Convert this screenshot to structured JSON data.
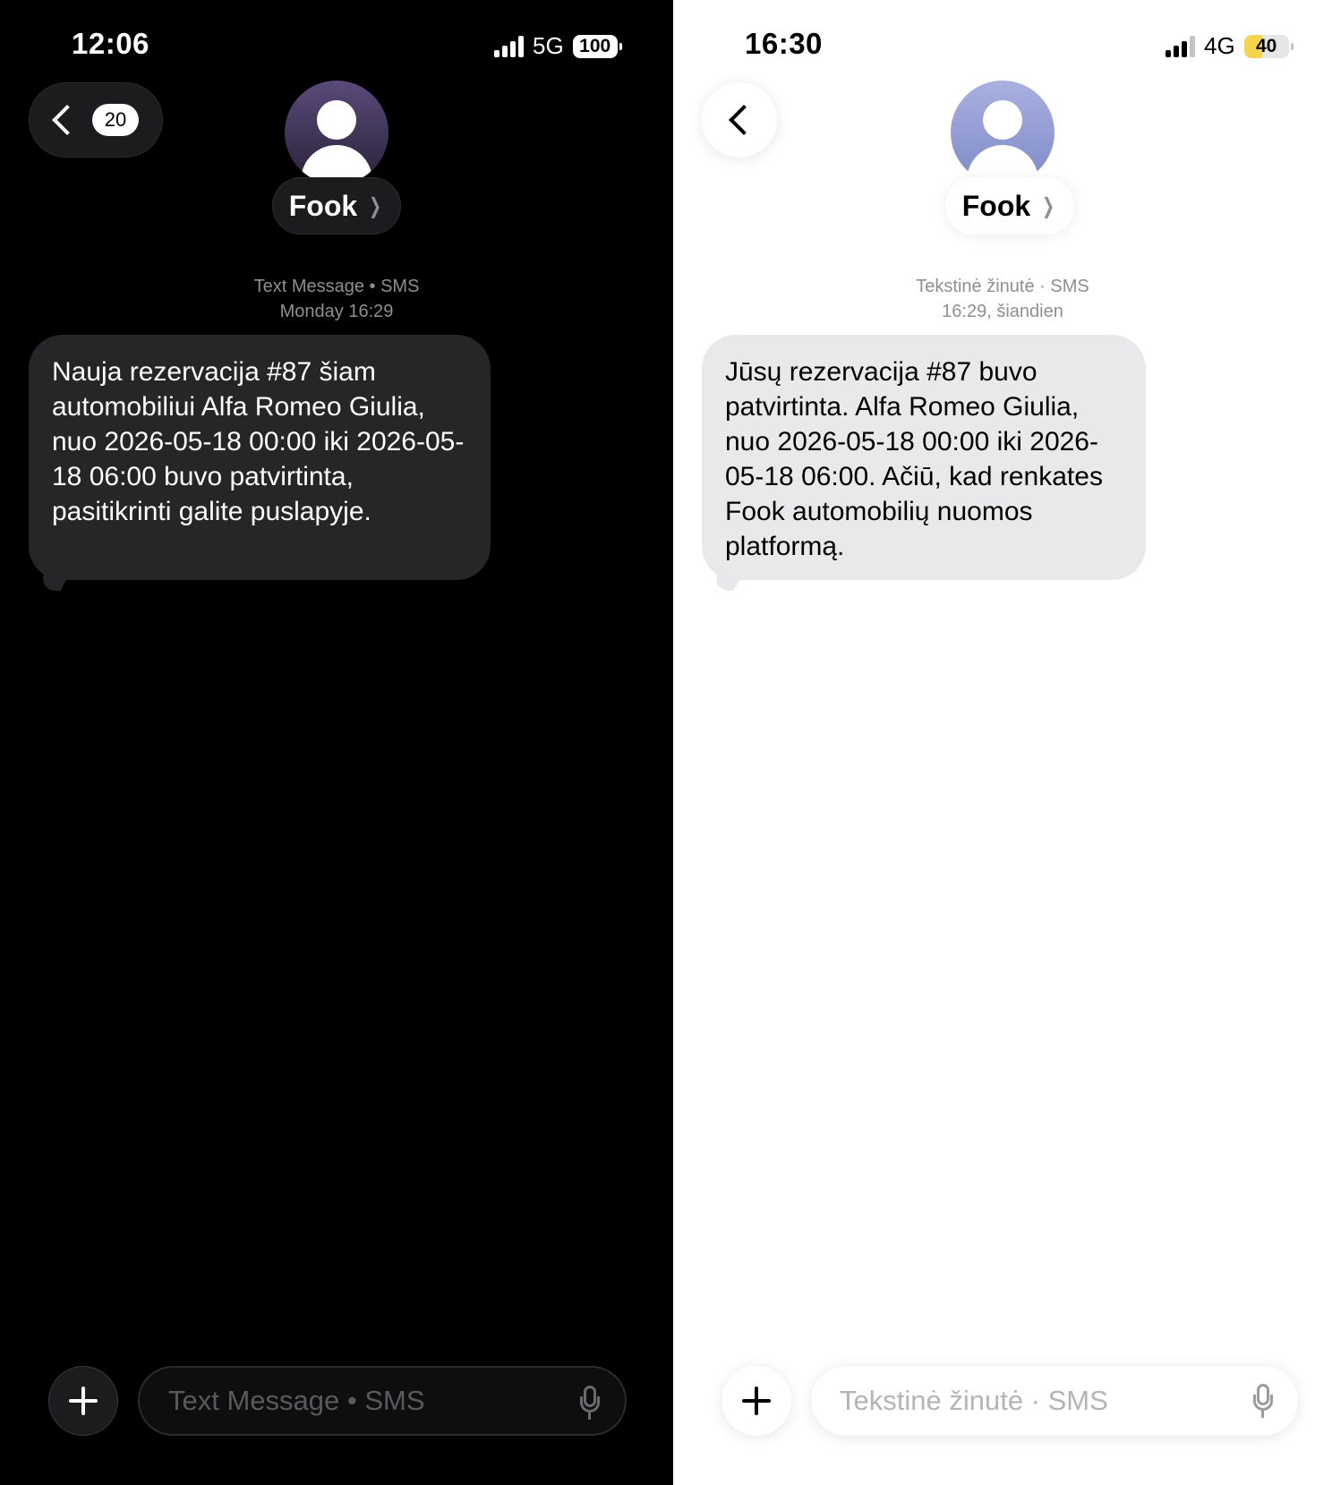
{
  "left": {
    "theme": "dark",
    "status": {
      "time": "12:06",
      "network": "5G",
      "battery": "100"
    },
    "back": {
      "badge": "20"
    },
    "contact": {
      "name": "Fook"
    },
    "meta": {
      "line1": "Text Message • SMS",
      "line2": "Monday 16:29"
    },
    "message": {
      "text": "Nauja rezervacija #87 šiam automobiliui Alfa Romeo Giulia, nuo 2026-05-18 00:00 iki 2026-05-18 06:00 buvo patvirtinta, pasitikrinti galite puslapyje."
    },
    "input": {
      "placeholder": "Text Message • SMS"
    },
    "colors": {
      "background": "#000000",
      "bubble": "#262628"
    }
  },
  "right": {
    "theme": "light",
    "status": {
      "time": "16:30",
      "network": "4G",
      "battery": "40"
    },
    "contact": {
      "name": "Fook"
    },
    "meta": {
      "line1": "Tekstinė žinutė · SMS",
      "line2": "16:29, šiandien"
    },
    "message": {
      "text": "Jūsų rezervacija #87 buvo patvirtinta. Alfa Romeo Giulia, nuo 2026-05-18 00:00 iki 2026-05-18 06:00. Ačiū, kad renkates Fook automobilių nuomos platformą."
    },
    "input": {
      "placeholder": "Tekstinė žinutė · SMS"
    },
    "colors": {
      "background": "#ffffff",
      "bubble": "#e9e9eb",
      "battery": "#f7d54a"
    }
  }
}
